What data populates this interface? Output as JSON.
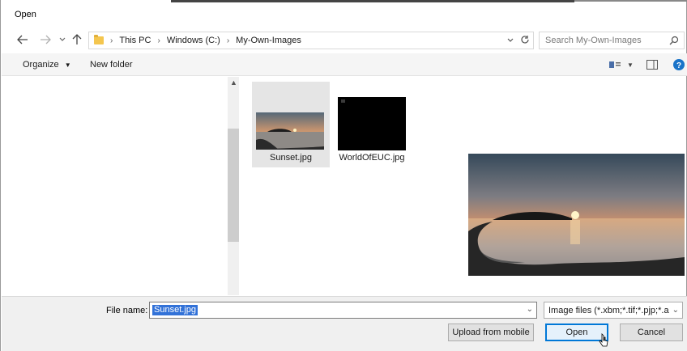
{
  "window": {
    "title": "Open"
  },
  "address_bar": {
    "crumbs": [
      "This PC",
      "Windows (C:)",
      "My-Own-Images"
    ]
  },
  "search": {
    "placeholder": "Search My-Own-Images"
  },
  "toolbar": {
    "organize_label": "Organize",
    "new_folder_label": "New folder"
  },
  "files": [
    {
      "name": "Sunset.jpg",
      "selected": true
    },
    {
      "name": "WorldOfEUC.jpg",
      "selected": false
    }
  ],
  "bottom": {
    "file_name_label": "File name:",
    "file_name_value": "Sunset.jpg",
    "file_type_value": "Image files (*.xbm;*.tif;*.pjp;*.a",
    "upload_label": "Upload from mobile",
    "open_label": "Open",
    "cancel_label": "Cancel"
  },
  "icons": {
    "back": "back-arrow-icon",
    "forward": "forward-arrow-icon",
    "recent": "recent-locations-icon",
    "up": "up-arrow-icon",
    "refresh": "refresh-icon",
    "search": "search-icon",
    "help": "help-icon"
  },
  "colors": {
    "selection": "#3272d8",
    "primary_border": "#0078d7",
    "help": "#1a73c8"
  }
}
